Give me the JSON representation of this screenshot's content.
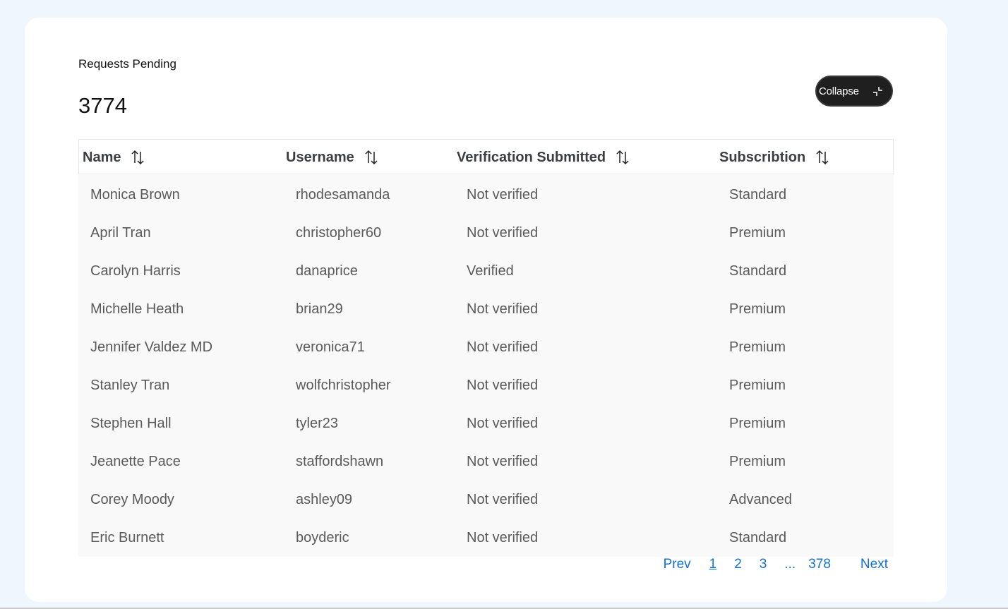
{
  "header": {
    "title": "Requests Pending",
    "count": "3774",
    "collapse_label": "Collapse"
  },
  "table": {
    "columns": [
      {
        "label": "Name",
        "sort_icon": "sort-updown-icon"
      },
      {
        "label": "Username",
        "sort_icon": "sort-updown-icon"
      },
      {
        "label": "Verification Submitted",
        "sort_icon": "sort-updown-icon"
      },
      {
        "label": "Subscribtion",
        "sort_icon": "sort-updown-icon"
      }
    ],
    "rows": [
      {
        "name": "Monica Brown",
        "username": "rhodesamanda",
        "verification": "Not verified",
        "subscription": "Standard"
      },
      {
        "name": "April Tran",
        "username": "christopher60",
        "verification": "Not verified",
        "subscription": "Premium"
      },
      {
        "name": "Carolyn Harris",
        "username": "danaprice",
        "verification": "Verified",
        "subscription": "Standard"
      },
      {
        "name": "Michelle Heath",
        "username": "brian29",
        "verification": "Not verified",
        "subscription": "Premium"
      },
      {
        "name": "Jennifer Valdez MD",
        "username": "veronica71",
        "verification": "Not verified",
        "subscription": "Premium"
      },
      {
        "name": "Stanley Tran",
        "username": "wolfchristopher",
        "verification": "Not verified",
        "subscription": "Premium"
      },
      {
        "name": "Stephen Hall",
        "username": "tyler23",
        "verification": "Not verified",
        "subscription": "Premium"
      },
      {
        "name": "Jeanette Pace",
        "username": "staffordshawn",
        "verification": "Not verified",
        "subscription": "Premium"
      },
      {
        "name": "Corey Moody",
        "username": "ashley09",
        "verification": "Not verified",
        "subscription": "Advanced"
      },
      {
        "name": "Eric Burnett",
        "username": "boyderic",
        "verification": "Not verified",
        "subscription": "Standard"
      }
    ]
  },
  "pagination": {
    "prev": "Prev",
    "pages": [
      "1",
      "2",
      "3"
    ],
    "ellipsis": "...",
    "last": "378",
    "next": "Next",
    "current": "1"
  }
}
